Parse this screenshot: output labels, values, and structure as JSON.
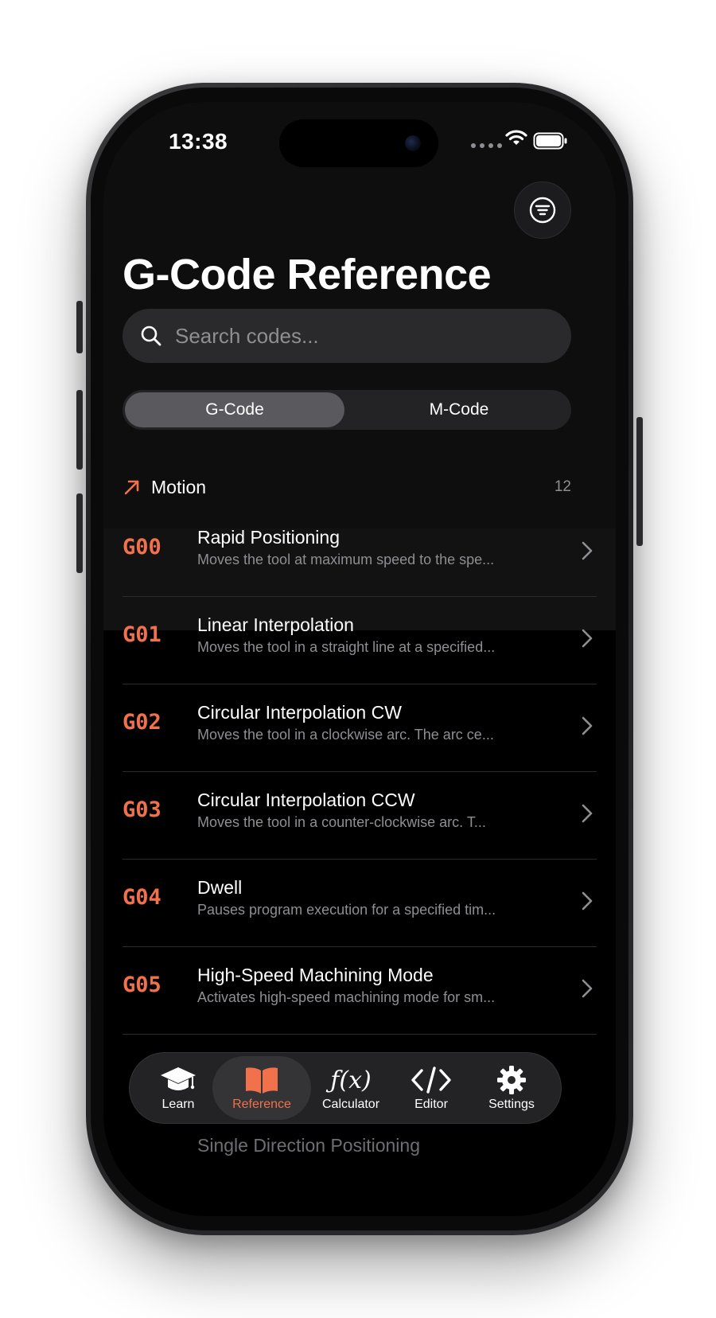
{
  "status_bar": {
    "time": "13:38"
  },
  "page": {
    "title": "G-Code Reference"
  },
  "search": {
    "placeholder": "Search codes..."
  },
  "segments": [
    {
      "label": "G-Code",
      "active": true
    },
    {
      "label": "M-Code",
      "active": false
    }
  ],
  "section": {
    "title": "Motion",
    "count": "12",
    "icon": "arrow-up-right-icon"
  },
  "codes": [
    {
      "code": "G00",
      "title": "Rapid Positioning",
      "description": "Moves the tool at maximum speed to the spe..."
    },
    {
      "code": "G01",
      "title": "Linear Interpolation",
      "description": "Moves the tool in a straight line at a specified..."
    },
    {
      "code": "G02",
      "title": "Circular Interpolation CW",
      "description": "Moves the tool in a clockwise arc. The arc ce..."
    },
    {
      "code": "G03",
      "title": "Circular Interpolation CCW",
      "description": "Moves the tool in a counter-clockwise arc. T..."
    },
    {
      "code": "G04",
      "title": "Dwell",
      "description": "Pauses program execution for a specified tim..."
    },
    {
      "code": "G05",
      "title": "High-Speed Machining Mode",
      "description": "Activates high-speed machining mode for sm..."
    }
  ],
  "peek_row": {
    "title": "Single Direction Positioning"
  },
  "tabbar": {
    "tabs": [
      {
        "label": "Learn",
        "icon": "graduation-cap-icon",
        "active": false
      },
      {
        "label": "Reference",
        "icon": "open-book-icon",
        "active": true
      },
      {
        "label": "Calculator",
        "icon": "function-icon",
        "active": false
      },
      {
        "label": "Editor",
        "icon": "code-brackets-icon",
        "active": false
      },
      {
        "label": "Settings",
        "icon": "gear-icon",
        "active": false
      }
    ]
  },
  "colors": {
    "accent": "#f0714b",
    "background": "#000000",
    "header_background": "#0e0e0e",
    "secondary_text": "#8e8e93",
    "separator": "#2a2a2c"
  }
}
